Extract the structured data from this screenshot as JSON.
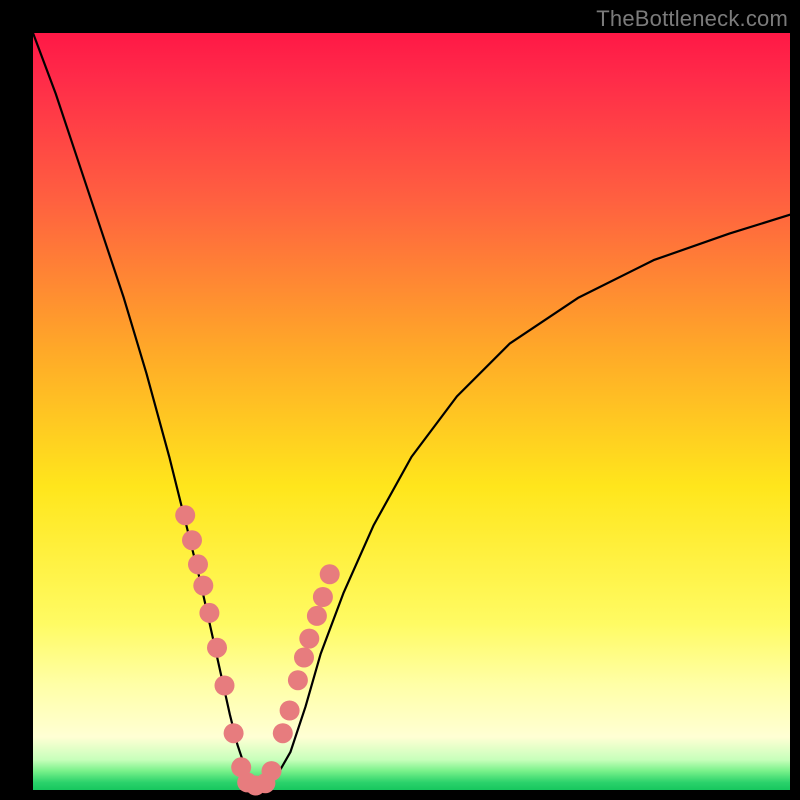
{
  "watermark": "TheBottleneck.com",
  "colors": {
    "dot": "#e77c7e",
    "curve": "#000000"
  },
  "chart_data": {
    "type": "line",
    "title": "",
    "xlabel": "",
    "ylabel": "",
    "xlim": [
      0,
      100
    ],
    "ylim": [
      0,
      100
    ],
    "grid": false,
    "series": [
      {
        "name": "bottleneck-curve",
        "x": [
          0,
          3,
          6,
          9,
          12,
          15,
          18,
          20,
          22,
          24,
          26,
          27,
          28,
          29,
          30,
          31,
          32,
          34,
          36,
          38,
          41,
          45,
          50,
          56,
          63,
          72,
          82,
          92,
          100
        ],
        "y": [
          100,
          92,
          83,
          74,
          65,
          55,
          44,
          36,
          28,
          19,
          10,
          6,
          3,
          1,
          0.5,
          0.6,
          1.5,
          5,
          11,
          18,
          26,
          35,
          44,
          52,
          59,
          65,
          70,
          73.5,
          76
        ]
      }
    ],
    "scatter": [
      {
        "name": "data-points",
        "x": [
          20.1,
          21.0,
          21.8,
          22.5,
          23.3,
          24.3,
          25.3,
          26.5,
          27.5,
          28.3,
          29.4,
          30.7,
          31.5,
          33.0,
          33.9,
          35.0,
          35.8,
          36.5,
          37.5,
          38.3,
          39.2
        ],
        "y": [
          36.3,
          33.0,
          29.8,
          27.0,
          23.4,
          18.8,
          13.8,
          7.5,
          3.0,
          1.0,
          0.6,
          0.9,
          2.5,
          7.5,
          10.5,
          14.5,
          17.5,
          20.0,
          23.0,
          25.5,
          28.5
        ],
        "r": [
          10,
          10,
          10,
          10,
          10,
          10,
          10,
          10,
          10,
          10,
          10,
          10,
          10,
          10,
          10,
          10,
          10,
          10,
          10,
          10,
          10
        ]
      }
    ]
  }
}
